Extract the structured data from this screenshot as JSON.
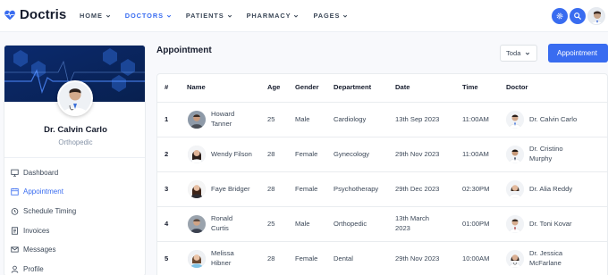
{
  "brand": {
    "name": "Doctris",
    "accent": "#396cf0",
    "logo_color": "#396cf0"
  },
  "nav": [
    {
      "label": "HOME",
      "active": false
    },
    {
      "label": "DOCTORS",
      "active": true
    },
    {
      "label": "PATIENTS",
      "active": false
    },
    {
      "label": "PHARMACY",
      "active": false
    },
    {
      "label": "PAGES",
      "active": false
    }
  ],
  "header_actions": {
    "settings_icon": "gear-icon",
    "search_icon": "search-icon",
    "avatar_icon": "user-avatar"
  },
  "profile": {
    "name": "Dr. Calvin Carlo",
    "specialty": "Orthopedic"
  },
  "sidebar_menu": [
    {
      "label": "Dashboard",
      "icon": "monitor-icon",
      "active": false
    },
    {
      "label": "Appointment",
      "icon": "calendar-icon",
      "active": true
    },
    {
      "label": "Schedule Timing",
      "icon": "clock-icon",
      "active": false
    },
    {
      "label": "Invoices",
      "icon": "invoice-icon",
      "active": false
    },
    {
      "label": "Messages",
      "icon": "mail-icon",
      "active": false
    },
    {
      "label": "Profile",
      "icon": "user-icon",
      "active": false
    }
  ],
  "main": {
    "title": "Appointment",
    "filter_value": "Toda",
    "primary_button": "Appointment",
    "columns": [
      "#",
      "Name",
      "Age",
      "Gender",
      "Department",
      "Date",
      "Time",
      "Doctor"
    ],
    "rows": [
      {
        "num": "1",
        "name_l1": "Howard",
        "name_l2": "Tanner",
        "age": "25",
        "gender": "Male",
        "department": "Cardiology",
        "date_l1": "13th Sep 2023",
        "date_l2": "",
        "time": "11:00AM",
        "doctor_l1": "Dr. Calvin Carlo",
        "doctor_l2": ""
      },
      {
        "num": "2",
        "name_l1": "Wendy Filson",
        "name_l2": "",
        "age": "28",
        "gender": "Female",
        "department": "Gynecology",
        "date_l1": "29th Nov 2023",
        "date_l2": "",
        "time": "11:00AM",
        "doctor_l1": "Dr. Cristino",
        "doctor_l2": "Murphy"
      },
      {
        "num": "3",
        "name_l1": "Faye Bridger",
        "name_l2": "",
        "age": "28",
        "gender": "Female",
        "department": "Psychotherapy",
        "date_l1": "29th Dec 2023",
        "date_l2": "",
        "time": "02:30PM",
        "doctor_l1": "Dr. Alia Reddy",
        "doctor_l2": ""
      },
      {
        "num": "4",
        "name_l1": "Ronald",
        "name_l2": "Curtis",
        "age": "25",
        "gender": "Male",
        "department": "Orthopedic",
        "date_l1": "13th March",
        "date_l2": "2023",
        "time": "01:00PM",
        "doctor_l1": "Dr. Toni Kovar",
        "doctor_l2": ""
      },
      {
        "num": "5",
        "name_l1": "Melissa",
        "name_l2": "Hibner",
        "age": "28",
        "gender": "Female",
        "department": "Dental",
        "date_l1": "29th Nov 2023",
        "date_l2": "",
        "time": "10:00AM",
        "doctor_l1": "Dr. Jessica",
        "doctor_l2": "McFarlane"
      }
    ]
  }
}
